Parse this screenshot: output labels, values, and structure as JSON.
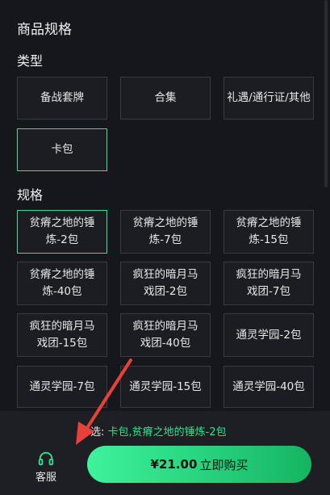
{
  "header": {
    "title": "商品规格"
  },
  "type_section": {
    "title": "类型",
    "options": [
      "备战套牌",
      "合集",
      "礼遇/通行证/其他",
      "卡包"
    ]
  },
  "spec_section": {
    "title": "规格",
    "options": [
      "贫瘠之地的锤炼-2包",
      "贫瘠之地的锤炼-7包",
      "贫瘠之地的锤炼-15包",
      "贫瘠之地的锤炼-40包",
      "疯狂的暗月马戏团-2包",
      "疯狂的暗月马戏团-7包",
      "疯狂的暗月马戏团-15包",
      "疯狂的暗月马戏团-40包",
      "通灵学园-2包",
      "通灵学园-7包",
      "通灵学园-15包",
      "通灵学园-40包"
    ]
  },
  "footer": {
    "selected_label": "选:",
    "selected_value": "卡包,贫瘠之地的锤炼-2包",
    "service_label": "客服",
    "price": "¥21.00",
    "buy_label": "立即购买"
  },
  "colors": {
    "accent": "#37e08a",
    "annotation_arrow": "#e8413a"
  }
}
